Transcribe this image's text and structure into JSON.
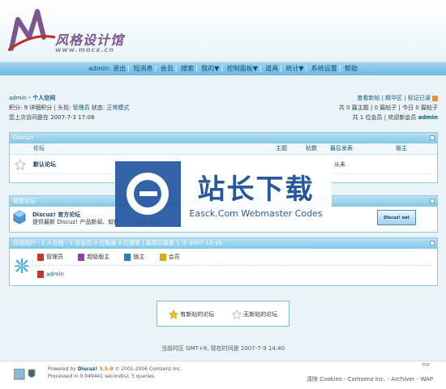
{
  "site": {
    "logo_title": "风格设计馆",
    "logo_url": "www.mocx.cn"
  },
  "nav": {
    "user": "admin:",
    "items": [
      "退出",
      "短消息",
      "会员",
      "搜索",
      "我的▼",
      "控制面板▼",
      "道具",
      "统计▼",
      "系统设置",
      "帮助"
    ]
  },
  "userbar": {
    "line1_user": "admin",
    "line1_link": "· 个人空间",
    "line2": "积分: 9 详细积分 | 头衔: ",
    "line2_title": "管理员",
    "line2_status_label": " 状态: ",
    "line2_status": "正常模式",
    "line3": "您上次访问是在 2007-7-3 17:08",
    "right1": "查看新帖 | 精华区 | 标记已读",
    "right2": "共 0 篇主题 | 0 篇帖子 | 今日 0 篇帖子",
    "right3": "共 1 位会员 | 欢迎新会员 ",
    "right3_user": "admin"
  },
  "forum_panel": {
    "title": "Discuz!",
    "headers": {
      "forum": "论坛",
      "topics": "主题",
      "posts": "帖数",
      "last": "最后发表",
      "mods": "版主"
    },
    "rows": [
      {
        "name": "默认论坛",
        "last": "从未"
      }
    ]
  },
  "links_panel": {
    "title": "联盟论坛",
    "name": "Discuz! 官方论坛",
    "desc": "提供最新 Discuz! 产品新闻、软件下载与技术交流",
    "button": "Discuz! net"
  },
  "online_panel": {
    "title": "在线用户",
    "summary": "- 1 人在线 - 1 位会员 0 位隐身 0 位游客 | 最高记录是 1 于 2007-12-19.",
    "legend": [
      "管理员",
      "超级版主",
      "版主",
      "会员"
    ],
    "users": [
      "admin"
    ]
  },
  "legend_box": {
    "new": "有新帖的论坛",
    "no_new": "无新帖的论坛"
  },
  "footer": {
    "time": "当前时区 GMT+8, 现在时间是 2007-7-9 14:40",
    "powered": "Powered by ",
    "powered_brand": "Discuz!",
    "powered_ver": " 5.5.0",
    "powered_rest": " © 2001-2006 Comsenz Inc.",
    "processed": "Processed in 0.949441 second(s), 5 queries",
    "right": "清除 Cookies - Comsenz Inc. - Archiver - WAP",
    "top": "TOP"
  },
  "watermark": {
    "cn": "站长下载",
    "en": "Easck.Com Webmaster Codes"
  },
  "colors": {
    "nav": "#7ec3e6",
    "panel_title": "#8ccbe8",
    "link": "#0b5a7f"
  }
}
